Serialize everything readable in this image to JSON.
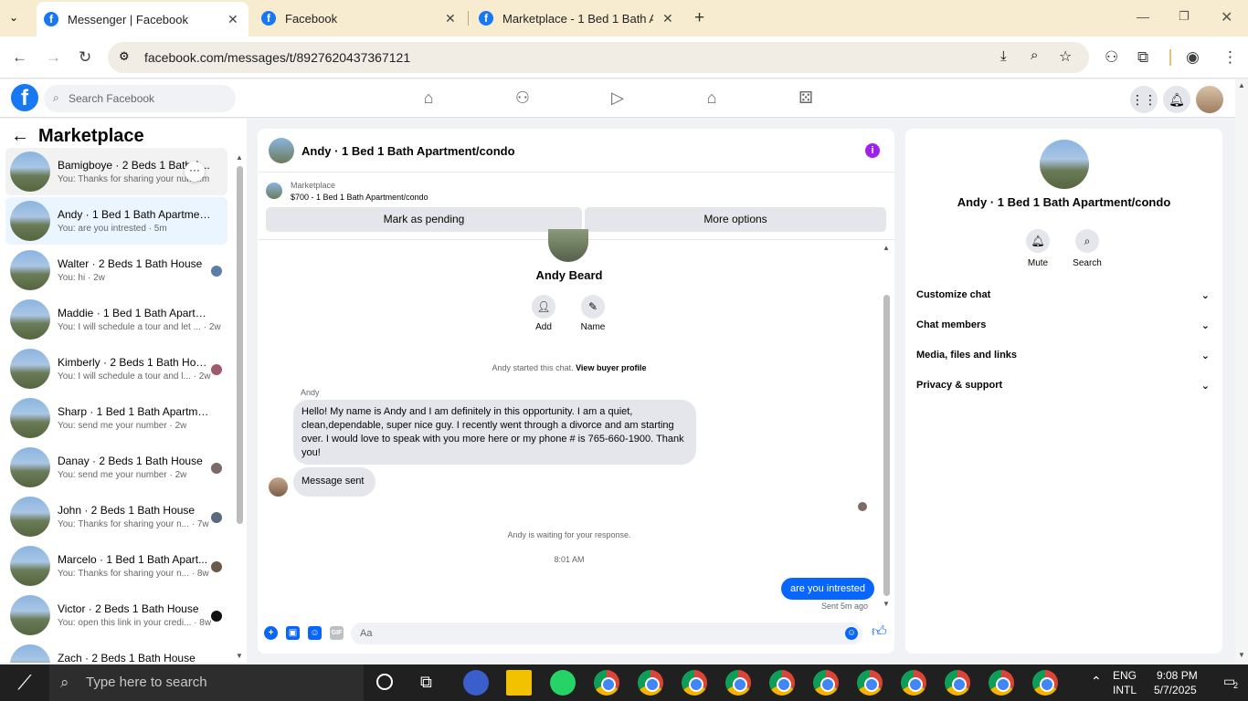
{
  "browser": {
    "tabs": [
      {
        "title": "Messenger | Facebook",
        "active": true
      },
      {
        "title": "Facebook",
        "active": false
      },
      {
        "title": "Marketplace - 1 Bed 1 Bath Apa",
        "active": false
      }
    ],
    "url": "facebook.com/messages/t/8927620437367121"
  },
  "fb": {
    "search_placeholder": "Search Facebook"
  },
  "left": {
    "title": "Marketplace",
    "conversations": [
      {
        "name": "Bamigboye · 2 Beds 1 Bath A...",
        "sub": "You: Thanks for sharing your num...m"
      },
      {
        "name": "Andy · 1 Bed 1 Bath Apartment/...",
        "sub": "You: are you intrested · 5m"
      },
      {
        "name": "Walter · 2 Beds 1 Bath House",
        "sub": "You: hi · 2w"
      },
      {
        "name": "Maddie · 1 Bed 1 Bath Apartme...",
        "sub": "You: I will schedule a tour and let ... · 2w"
      },
      {
        "name": "Kimberly · 2 Beds 1 Bath House",
        "sub": "You: I will schedule a tour and l... · 2w"
      },
      {
        "name": "Sharp · 1 Bed 1 Bath Apartment...",
        "sub": "You: send me your number · 2w"
      },
      {
        "name": "Danay · 2 Beds 1 Bath House",
        "sub": "You: send me your number · 2w"
      },
      {
        "name": "John · 2 Beds 1 Bath House",
        "sub": "You: Thanks for sharing your n... · 7w"
      },
      {
        "name": "Marcelo · 1 Bed 1 Bath Apart...",
        "sub": "You: Thanks for sharing your n... · 8w"
      },
      {
        "name": "Victor · 2 Beds 1 Bath House",
        "sub": "You: open this link in your credi... · 8w"
      },
      {
        "name": "Zach · 2 Beds 1 Bath House",
        "sub": ""
      }
    ]
  },
  "chat": {
    "header_title": "Andy · 1 Bed 1 Bath Apartment/condo",
    "marketplace_label": "Marketplace",
    "listing": "$700 - 1 Bed 1 Bath Apartment/condo",
    "mark_pending": "Mark as pending",
    "more_options": "More options",
    "profile_name": "Andy Beard",
    "add_label": "Add",
    "name_label": "Name",
    "started_text": "Andy started this chat.",
    "view_profile": "View buyer profile",
    "sender": "Andy",
    "message1": "Hello! My name is Andy and  I am definitely in this opportunity. I am a quiet, clean,dependable,  super nice guy. I recently went through a divorce and am starting over. I would love to speak with you more here or my phone # is 765-660-1900. Thank you!",
    "message2": "Message sent",
    "waiting": "Andy is waiting for your response.",
    "time": "8:01 AM",
    "my_message": "are you intrested",
    "sent_status": "Sent 5m ago",
    "input_placeholder": "Aa"
  },
  "right": {
    "title": "Andy · 1 Bed 1 Bath Apartment/condo",
    "mute": "Mute",
    "search": "Search",
    "sections": [
      "Customize chat",
      "Chat members",
      "Media, files and links",
      "Privacy & support"
    ]
  },
  "taskbar": {
    "search_placeholder": "Type here to search",
    "lang1": "ENG",
    "lang2": "INTL",
    "time": "9:08 PM",
    "date": "5/7/2025",
    "notif": "2"
  },
  "colors": {
    "fb_blue": "#1877f2",
    "messenger_blue": "#0866ff",
    "info_purple": "#a020f0"
  }
}
